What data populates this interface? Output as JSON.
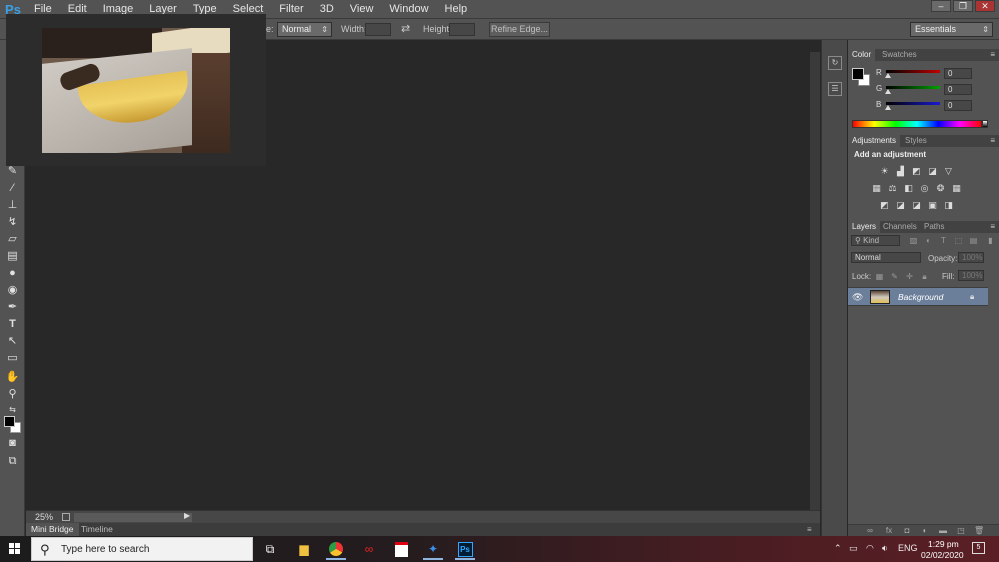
{
  "app": {
    "logo": "Ps"
  },
  "menu": [
    "File",
    "Edit",
    "Image",
    "Layer",
    "Type",
    "Select",
    "Filter",
    "3D",
    "View",
    "Window",
    "Help"
  ],
  "window_controls": {
    "minimize": "–",
    "restore": "❐",
    "close": "✕"
  },
  "options": {
    "style_label": "e:",
    "style_value": "Normal",
    "width_label": "Width:",
    "height_label": "Height:",
    "swap_icon": "⇄",
    "refine_label": "Refine Edge...",
    "workspace": "Essentials"
  },
  "status": {
    "zoom": "25%"
  },
  "bottom_tabs": [
    "Mini Bridge",
    "Timeline"
  ],
  "color_panel": {
    "tabs": [
      "Color",
      "Swatches"
    ],
    "sliders": [
      {
        "label": "R",
        "value": "0",
        "gradient": "#c00000"
      },
      {
        "label": "G",
        "value": "0",
        "gradient": "#00a000"
      },
      {
        "label": "B",
        "value": "0",
        "gradient": "#1a1ad0"
      }
    ]
  },
  "adjustments_panel": {
    "tabs": [
      "Adjustments",
      "Styles"
    ],
    "heading": "Add an adjustment"
  },
  "layers_panel": {
    "tabs": [
      "Layers",
      "Channels",
      "Paths"
    ],
    "filter": "Kind",
    "blend_mode": "Normal",
    "opacity_label": "Opacity:",
    "opacity_value": "100%",
    "lock_label": "Lock:",
    "fill_label": "Fill:",
    "fill_value": "100%",
    "layers": [
      {
        "name": "Background",
        "visible": true,
        "locked": true
      }
    ]
  },
  "taskbar": {
    "search_placeholder": "Type here to search",
    "apps": [
      "task-view",
      "file-explorer",
      "chrome",
      "creative-cloud",
      "acrobat",
      "azure",
      "photoshop"
    ],
    "photoshop_label": "Ps",
    "language": "ENG",
    "time": "1:29 pm",
    "date": "02/02/2020",
    "notification_count": "5"
  }
}
